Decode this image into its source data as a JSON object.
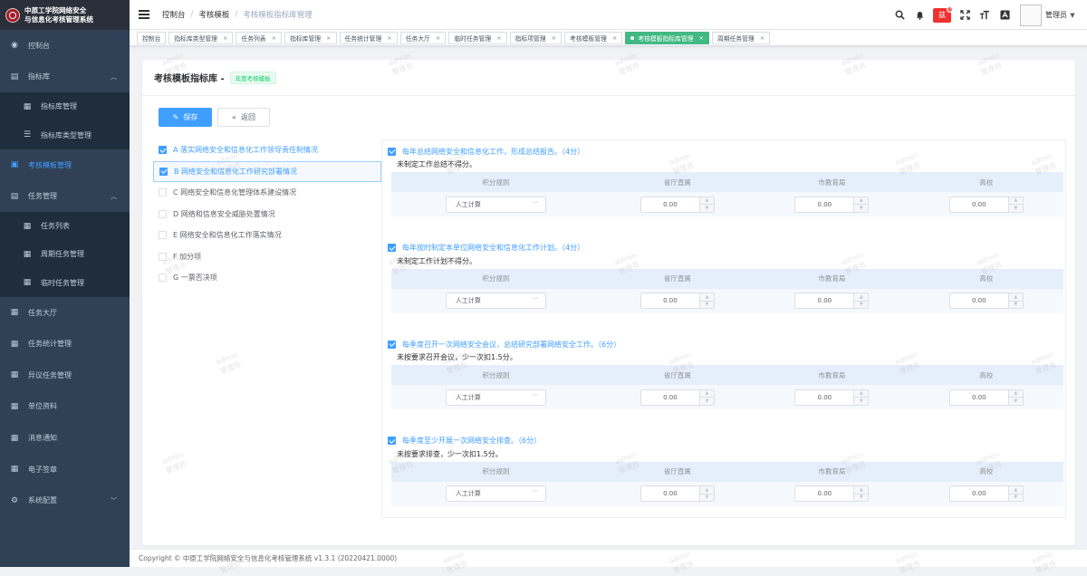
{
  "app": {
    "logo_line1": "中原工学院网络安全",
    "logo_line2": "与信息化考核管理系统"
  },
  "sidebar": {
    "items": [
      {
        "label": "控制台",
        "icon": "dashboard-icon",
        "type": "top"
      },
      {
        "label": "指标库",
        "icon": "clipboard-icon",
        "type": "group",
        "expanded": true
      },
      {
        "label": "指标库管理",
        "icon": "document-icon",
        "type": "sub"
      },
      {
        "label": "指标库类型管理",
        "icon": "list-icon",
        "type": "sub"
      },
      {
        "label": "考核模板管理",
        "icon": "template-icon",
        "type": "top",
        "active": true
      },
      {
        "label": "任务管理",
        "icon": "task-icon",
        "type": "group",
        "expanded": true
      },
      {
        "label": "任务列表",
        "icon": "document-icon",
        "type": "sub"
      },
      {
        "label": "周期任务管理",
        "icon": "document-icon",
        "type": "sub"
      },
      {
        "label": "临时任务管理",
        "icon": "document-icon",
        "type": "sub"
      },
      {
        "label": "任务大厅",
        "icon": "document-icon",
        "type": "top"
      },
      {
        "label": "任务统计管理",
        "icon": "document-icon",
        "type": "top"
      },
      {
        "label": "异议任务管理",
        "icon": "document-icon",
        "type": "top"
      },
      {
        "label": "单位资料",
        "icon": "document-icon",
        "type": "top"
      },
      {
        "label": "消息通知",
        "icon": "document-icon",
        "type": "top"
      },
      {
        "label": "电子签章",
        "icon": "document-icon",
        "type": "top"
      },
      {
        "label": "系统配置",
        "icon": "gear-icon",
        "type": "group",
        "expanded": false
      }
    ]
  },
  "breadcrumb": [
    "控制台",
    "考核模板",
    "考核模板指标库管理"
  ],
  "navbar": {
    "badge_text": "兹",
    "username": "管理员"
  },
  "tags": [
    {
      "label": "控制台",
      "active": false
    },
    {
      "label": "指标库类型管理",
      "active": false
    },
    {
      "label": "任务列表",
      "active": false
    },
    {
      "label": "指标库管理",
      "active": false
    },
    {
      "label": "任务统计管理",
      "active": false
    },
    {
      "label": "任务大厅",
      "active": false
    },
    {
      "label": "临时任务管理",
      "active": false
    },
    {
      "label": "指标项管理",
      "active": false
    },
    {
      "label": "考核模板管理",
      "active": false
    },
    {
      "label": "考核模板指标库管理",
      "active": true
    },
    {
      "label": "周期任务管理",
      "active": false
    }
  ],
  "card": {
    "title": "考核模板指标库 -",
    "type_tag": "年度考核模板"
  },
  "buttons": {
    "save": "保存",
    "back": "返回"
  },
  "categories": [
    {
      "label": "A 落实网络安全和信息化工作领导责任制情况",
      "checked": true,
      "selected": false
    },
    {
      "label": "B 网络安全和信息化工作研究部署情况",
      "checked": true,
      "selected": true
    },
    {
      "label": "C 网络安全和信息化管理体系建设情况",
      "checked": false,
      "selected": false
    },
    {
      "label": "D 网络和信息安全威胁处置情况",
      "checked": false,
      "selected": false
    },
    {
      "label": "E 网络安全和信息化工作落实情况",
      "checked": false,
      "selected": false
    },
    {
      "label": "F 加分项",
      "checked": false,
      "selected": false
    },
    {
      "label": "G 一票否决项",
      "checked": false,
      "selected": false
    }
  ],
  "table_headers": [
    "积分规则",
    "省厅直属",
    "市教育局",
    "高校"
  ],
  "items": [
    {
      "title": "每年总结网络安全和信息化工作，形成总结报告。（4分）",
      "desc": "未制定工作总结不得分。",
      "rule": "人工计算",
      "values": [
        "0.00",
        "0.00",
        "0.00"
      ]
    },
    {
      "title": "每年按时制定本单位网络安全和信息化工作计划。（4分）",
      "desc": "未制定工作计划不得分。",
      "rule": "人工计算",
      "values": [
        "0.00",
        "0.00",
        "0.00"
      ]
    },
    {
      "title": "每季度召开一次网络安全会议，总结研究部署网络安全工作。（6分）",
      "desc": "未按要求召开会议，少一次扣1.5分。",
      "rule": "人工计算",
      "values": [
        "0.00",
        "0.00",
        "0.00"
      ]
    },
    {
      "title": "每季度至少开展一次网络安全排查。（6分）",
      "desc": "未按要求排查，少一次扣1.5分。",
      "rule": "人工计算",
      "values": [
        "0.00",
        "0.00",
        "0.00"
      ]
    }
  ],
  "footer": "Copyright © 中原工学院网络安全与信息化考核管理系统 v1.3.1 (20220421.0000)",
  "watermark": {
    "line1": "admin",
    "line2": "管理员"
  },
  "colors": {
    "primary": "#409eff",
    "sidebar": "#304156",
    "tag_active": "#42b983",
    "badge_red": "#f23030"
  }
}
